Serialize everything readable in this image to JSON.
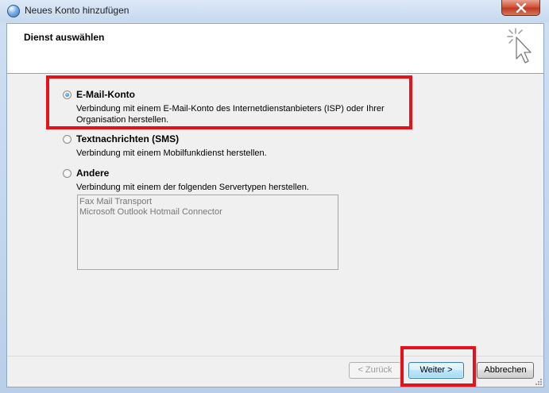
{
  "window": {
    "title": "Neues Konto hinzufügen",
    "close_icon": "close-icon"
  },
  "header": {
    "title": "Dienst auswählen",
    "icon": "cursor-click-icon"
  },
  "options": [
    {
      "label": "E-Mail-Konto",
      "description_line1": "Verbindung mit einem E-Mail-Konto des Internetdienstanbieters (ISP) oder Ihrer",
      "description_line2": "Organisation herstellen.",
      "checked": true
    },
    {
      "label": "Textnachrichten (SMS)",
      "description_line1": "Verbindung mit einem Mobilfunkdienst herstellen.",
      "checked": false
    },
    {
      "label": "Andere",
      "description_line1": "Verbindung mit einem der folgenden Servertypen herstellen.",
      "checked": false
    }
  ],
  "server_types": [
    "Fax Mail Transport",
    "Microsoft Outlook Hotmail Connector"
  ],
  "buttons": {
    "back": "< Zurück",
    "next": "Weiter >",
    "cancel": "Abbrechen"
  },
  "colors": {
    "highlight": "#e3121b",
    "window_frame": "#b9cfe8",
    "close_button": "#c03a22"
  }
}
